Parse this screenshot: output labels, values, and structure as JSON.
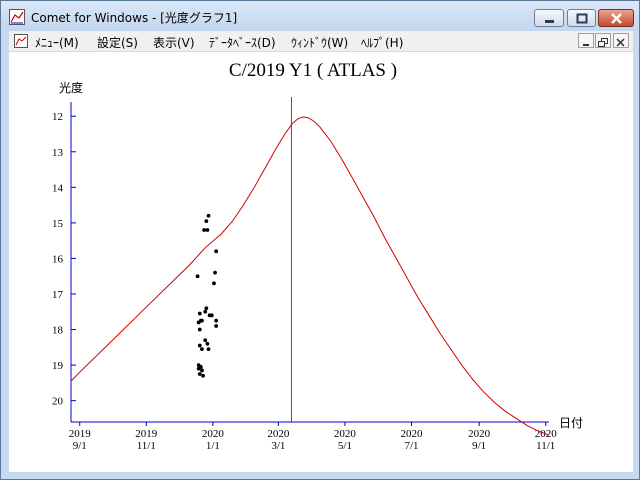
{
  "window": {
    "title": "Comet for Windows - [光度グラフ1]",
    "colors": {
      "titlebar": "#c9daf0",
      "close": "#c14a32"
    }
  },
  "menu": {
    "items": [
      "ﾒﾆｭｰ(M)",
      "設定(S)",
      "表示(V)",
      "ﾃﾞｰﾀﾍﾞｰｽ(D)",
      "ｳｨﾝﾄﾞｳ(W)",
      "ﾍﾙﾌﾟ(H)"
    ]
  },
  "chart_data": {
    "type": "scatter",
    "title": "C/2019 Y1 ( ATLAS )",
    "ylabel": "光度",
    "xlabel": "日付",
    "ylim": [
      20.6,
      11.6
    ],
    "y_ticks": [
      "12",
      "13",
      "14",
      "15",
      "16",
      "17",
      "18",
      "19",
      "20"
    ],
    "x_ticks": [
      {
        "year": "2019",
        "date": "9/1",
        "days": 0
      },
      {
        "year": "2019",
        "date": "11/1",
        "days": 61
      },
      {
        "year": "2020",
        "date": "1/1",
        "days": 122
      },
      {
        "year": "2020",
        "date": "3/1",
        "days": 182
      },
      {
        "year": "2020",
        "date": "5/1",
        "days": 243
      },
      {
        "year": "2020",
        "date": "7/1",
        "days": 304
      },
      {
        "year": "2020",
        "date": "9/1",
        "days": 366
      },
      {
        "year": "2020",
        "date": "11/1",
        "days": 427
      }
    ],
    "marker_date_days": 194,
    "colors": {
      "curve": "#d00000",
      "marker": "#cc00cc",
      "axis": "#0000cc",
      "points": "#000000"
    },
    "series": [
      {
        "kind": "prediction",
        "x": [
          -8,
          0,
          20,
          40,
          60,
          80,
          100,
          115,
          130,
          140,
          150,
          160,
          170,
          180,
          188,
          195,
          200,
          205,
          210,
          215,
          220,
          230,
          240,
          250,
          260,
          270,
          280,
          290,
          300,
          310,
          320,
          330,
          340,
          350,
          360,
          370,
          380,
          390,
          400,
          410,
          420,
          430
        ],
        "y": [
          19.45,
          19.2,
          18.6,
          18.0,
          17.4,
          16.8,
          16.2,
          15.7,
          15.3,
          14.95,
          14.5,
          14.0,
          13.45,
          12.9,
          12.5,
          12.2,
          12.07,
          12.02,
          12.05,
          12.15,
          12.3,
          12.7,
          13.2,
          13.75,
          14.3,
          14.85,
          15.45,
          16.0,
          16.55,
          17.1,
          17.6,
          18.1,
          18.55,
          19.0,
          19.4,
          19.75,
          20.05,
          20.3,
          20.5,
          20.7,
          20.85,
          20.97
        ]
      },
      {
        "kind": "observations",
        "points": [
          [
            116,
            14.95
          ],
          [
            118,
            14.8
          ],
          [
            114,
            15.2
          ],
          [
            117,
            15.2
          ],
          [
            125,
            15.8
          ],
          [
            124,
            16.4
          ],
          [
            123,
            16.7
          ],
          [
            108,
            16.5
          ],
          [
            116,
            17.4
          ],
          [
            115,
            17.5
          ],
          [
            119,
            17.6
          ],
          [
            121,
            17.6
          ],
          [
            110,
            17.55
          ],
          [
            111,
            17.75
          ],
          [
            109,
            17.8
          ],
          [
            112,
            17.75
          ],
          [
            125,
            17.75
          ],
          [
            125,
            17.9
          ],
          [
            110,
            18.0
          ],
          [
            115,
            18.3
          ],
          [
            117,
            18.4
          ],
          [
            110,
            18.45
          ],
          [
            112,
            18.55
          ],
          [
            118,
            18.55
          ],
          [
            109,
            19.0
          ],
          [
            111,
            19.05
          ],
          [
            109,
            19.1
          ],
          [
            112,
            19.15
          ],
          [
            110,
            19.25
          ],
          [
            113,
            19.3
          ]
        ]
      }
    ]
  }
}
